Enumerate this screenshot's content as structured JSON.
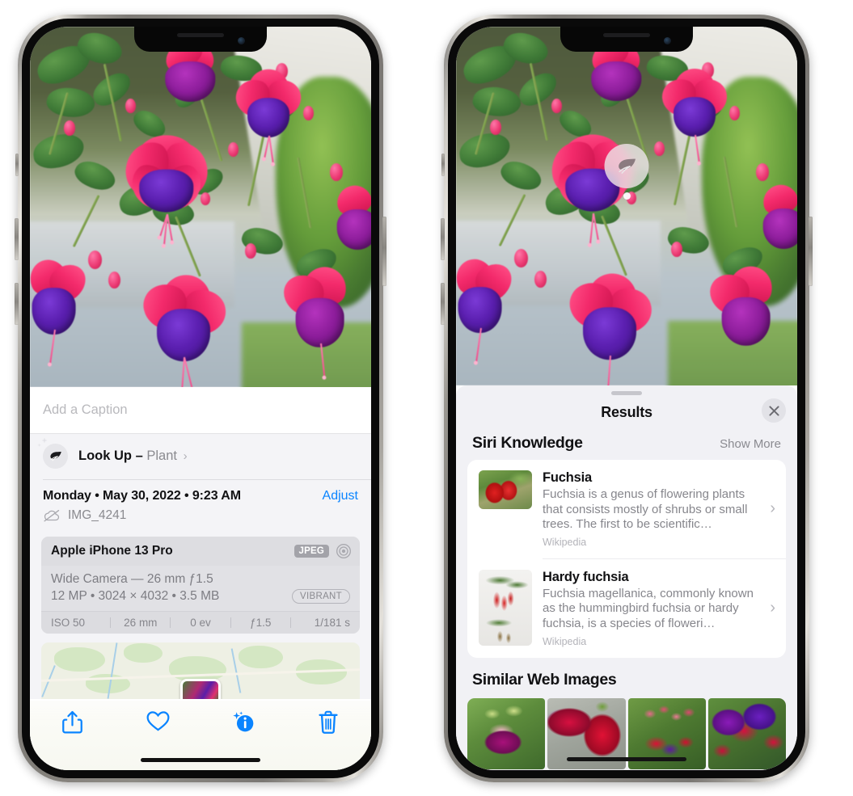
{
  "left_phone": {
    "caption": {
      "placeholder": "Add a Caption",
      "value": ""
    },
    "lookup": {
      "icon": "leaf-icon",
      "label_bold": "Look Up –",
      "label_subject": "Plant",
      "chevron": "›"
    },
    "meta": {
      "date": "Monday • May 30, 2022 • 9:23 AM",
      "adjust_label": "Adjust",
      "cloud_icon": "cloud-slash-icon",
      "filename": "IMG_4241"
    },
    "exif": {
      "device": "Apple iPhone 13 Pro",
      "format_badge": "JPEG",
      "lens_icon": "aperture-icon",
      "lens_line": "Wide Camera — 26 mm ƒ1.5",
      "size_line": "12 MP • 3024 × 4032 • 3.5 MB",
      "style_badge": "VIBRANT",
      "settings": [
        "ISO 50",
        "26 mm",
        "0 ev",
        "ƒ1.5",
        "1/181 s"
      ]
    },
    "map": {
      "pin_label": "photo-thumbnail-pin"
    },
    "toolbar": [
      {
        "name": "share-icon",
        "label": "Share"
      },
      {
        "name": "heart-icon",
        "label": "Favorite"
      },
      {
        "name": "info-sparkle-icon",
        "label": "Info"
      },
      {
        "name": "trash-icon",
        "label": "Delete"
      }
    ]
  },
  "right_phone": {
    "photo_badge": {
      "icon": "leaf-icon",
      "name": "visual-lookup-badge"
    },
    "sheet": {
      "title": "Results",
      "close_icon": "close-icon"
    },
    "siri_knowledge": {
      "title": "Siri Knowledge",
      "show_more": "Show More",
      "items": [
        {
          "title": "Fuchsia",
          "description": "Fuchsia is a genus of flowering plants that consists mostly of shrubs or small trees. The first to be scientific…",
          "source": "Wikipedia",
          "thumb": "fuchsia-flowers-thumbnail",
          "chevron": "›"
        },
        {
          "title": "Hardy fuchsia",
          "description": "Fuchsia magellanica, commonly known as the hummingbird fuchsia or hardy fuchsia, is a species of floweri…",
          "source": "Wikipedia",
          "thumb": "hardy-fuchsia-specimen-thumbnail",
          "chevron": "›"
        }
      ]
    },
    "similar_web_images": {
      "title": "Similar Web Images",
      "items": [
        "fuchsia-pink-white-bloom",
        "fuchsia-red-closeup",
        "fuchsia-shrub-buds",
        "fuchsia-purple-red-cluster"
      ]
    }
  },
  "colors": {
    "accent_blue": "#0a84ff",
    "sheet_bg": "#f1f1f5",
    "card_bg": "#ffffff",
    "secondary_text": "#86868c",
    "primary_text": "#111113"
  }
}
